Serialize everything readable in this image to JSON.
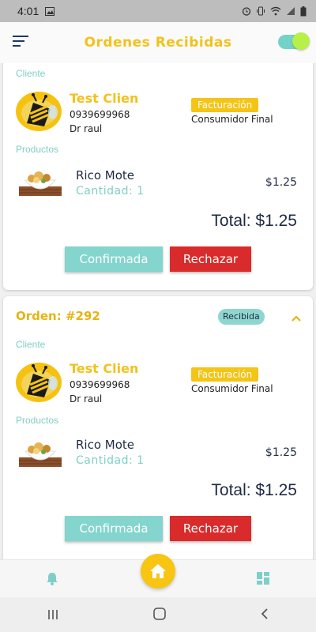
{
  "status_bar": {
    "time": "4:01"
  },
  "app_bar": {
    "title": "Ordenes Recibidas"
  },
  "orders": [
    {
      "number": "",
      "status": "",
      "client_label": "Cliente",
      "client_name": "Test Clien",
      "phone": "0939699968",
      "address": "Dr raul",
      "billing_label": "Facturación",
      "billing_value": "Consumidor Final",
      "products_label": "Productos",
      "product_name": "Rico Mote",
      "quantity": "Cantidad: 1",
      "price": "$1.25",
      "total": "Total: $1.25",
      "confirm_label": "Confirmada",
      "reject_label": "Rechazar"
    },
    {
      "number": "Orden: #292",
      "status": "Recibida",
      "client_label": "Cliente",
      "client_name": "Test Clien",
      "phone": "0939699968",
      "address": "Dr raul",
      "billing_label": "Facturación",
      "billing_value": "Consumidor Final",
      "products_label": "Productos",
      "product_name": "Rico Mote",
      "quantity": "Cantidad: 1",
      "price": "$1.25",
      "total": "Total: $1.25",
      "confirm_label": "Confirmada",
      "reject_label": "Rechazar"
    }
  ],
  "icons": {
    "menu": "menu-icon",
    "toggle": "toggle-switch",
    "bell": "bell-icon",
    "home": "home-icon",
    "dashboard": "dashboard-icon"
  },
  "colors": {
    "accent_yellow": "#f2c21b",
    "teal": "#83d5cd",
    "reject_red": "#d92b2b",
    "navy": "#1e2a44"
  }
}
